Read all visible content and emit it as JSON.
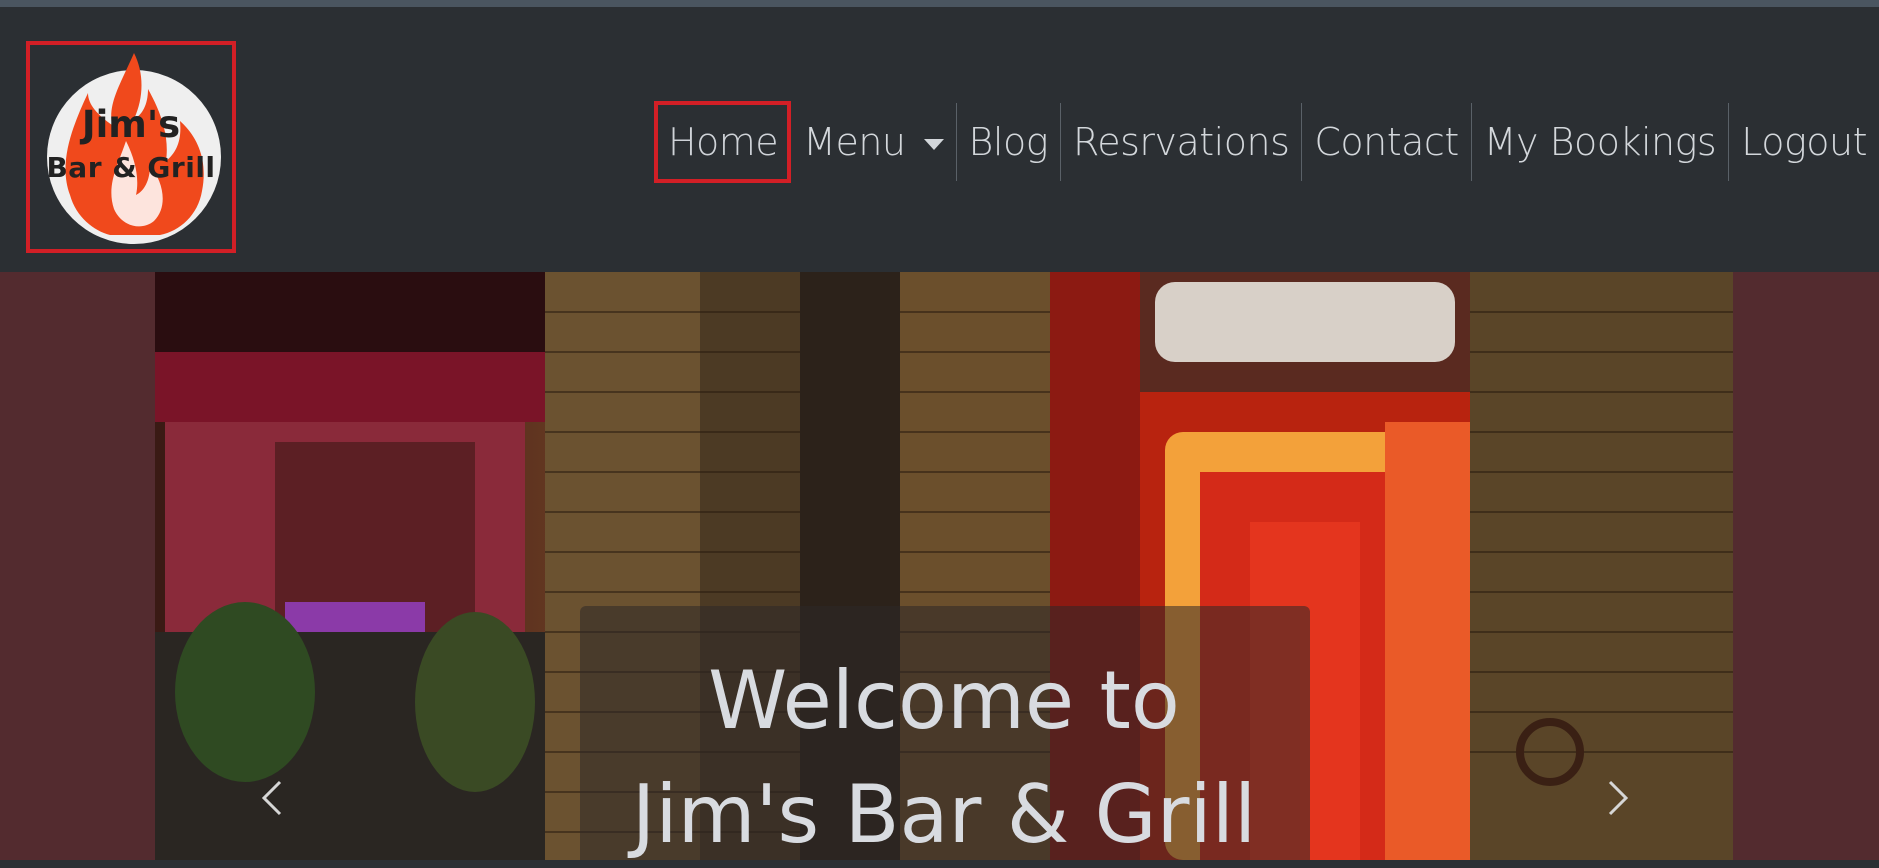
{
  "brand": {
    "logo_line1": "Jim's",
    "logo_line2": "Bar & Grill",
    "flame_color": "#f0491c"
  },
  "nav": {
    "items": [
      {
        "label": "Home",
        "active": true
      },
      {
        "label": "Menu",
        "dropdown": true
      },
      {
        "label": "Blog"
      },
      {
        "label": "Resrvations"
      },
      {
        "label": "Contact"
      },
      {
        "label": "My Bookings"
      },
      {
        "label": "Logout"
      }
    ]
  },
  "hero": {
    "title_line1": "Welcome to",
    "title_line2": "Jim's Bar & Grill",
    "prev_icon": "chevron-left-icon",
    "next_icon": "chevron-right-icon"
  },
  "colors": {
    "navbar_bg": "#2b2f33",
    "hero_bg": "#532b2f",
    "highlight_border": "#d21f26",
    "nav_text": "#d3d7db"
  }
}
